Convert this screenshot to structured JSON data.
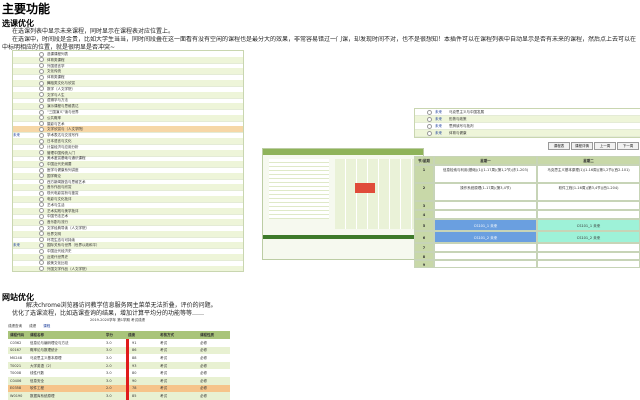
{
  "page": {
    "title": "主要功能"
  },
  "sec1": {
    "title": "选课优化",
    "lines": [
      "在选课列表中显示未来课程，同时显示在课程表对应位置上。",
      "在选课中，时间段是金贵，比如大学生当当，同时间段叠在这一面看有没有空闲的课程也是最分大的效果，非常容易错过一门课，却发现时间不对，也不是很想知！本插件可以在课程列表中自动显示是否有未来的课程，然后点上去可以在课程",
      "中标明相应的位置，就是很明显是否冲突~"
    ]
  },
  "tree_rows": [
    {
      "tag": "",
      "text": "选课课程列表"
    },
    {
      "tag": "",
      "text": "体育类课程"
    },
    {
      "tag": "",
      "text": "外国语言学"
    },
    {
      "tag": "",
      "text": "文化传统"
    },
    {
      "tag": "",
      "text": "体育类课程"
    },
    {
      "tag": "",
      "text": "舞蹈类文化与欣赏"
    },
    {
      "tag": "",
      "text": "数学（人文学院）"
    },
    {
      "tag": "",
      "text": "文学与人生"
    },
    {
      "tag": "",
      "text": "逻辑学与方法"
    },
    {
      "tag": "",
      "text": "演示课程与思维表达"
    },
    {
      "tag": "",
      "text": "“三国演义”读与世界"
    },
    {
      "tag": "",
      "text": "公共概率"
    },
    {
      "tag": "",
      "text": "摄影与艺术"
    },
    {
      "tag": "",
      "text": "文学欣赏与（人文学院）"
    },
    {
      "tag": "未来",
      "text": "学术表达与交流写作"
    },
    {
      "tag": "",
      "text": "日本语言与文化"
    },
    {
      "tag": "",
      "text": "计量经济与应用分析"
    },
    {
      "tag": "",
      "text": "管理中国传统入门"
    },
    {
      "tag": "",
      "text": "美术鉴赏基础与通识课程"
    },
    {
      "tag": "",
      "text": "中国近代史纲要"
    },
    {
      "tag": "",
      "text": "医学与健康系列讲座"
    },
    {
      "tag": "",
      "text": "国学概论"
    },
    {
      "tag": "",
      "text": "西方新闻报告与思维艺术"
    },
    {
      "tag": "",
      "text": "音乐作品与欣赏"
    },
    {
      "tag": "",
      "text": "现代电影赏析与鉴赏"
    },
    {
      "tag": "",
      "text": "电影与文化批评"
    },
    {
      "tag": "",
      "text": "艺术与生活"
    },
    {
      "tag": "",
      "text": "艺术实践与美学批评"
    },
    {
      "tag": "",
      "text": "中国书法艺术"
    },
    {
      "tag": "",
      "text": "音乐剧与流行"
    },
    {
      "tag": "",
      "text": "文学经典导读（人文学院）"
    },
    {
      "tag": "",
      "text": "世界文明"
    },
    {
      "tag": "",
      "text": "环境生态与可持续"
    },
    {
      "tag": "未来",
      "text": "国际关系与世界（世界以政和平）"
    },
    {
      "tag": "",
      "text": "中国近代经济史"
    },
    {
      "tag": "",
      "text": "近现代世界史"
    },
    {
      "tag": "",
      "text": "欧美文化比较"
    },
    {
      "tag": "",
      "text": "外国文学作品（人文学院）"
    }
  ],
  "top_rows": [
    {
      "tag": "未来",
      "text": "马克思主义与中国发展"
    },
    {
      "tag": "未来",
      "text": "形势与政策"
    },
    {
      "tag": "未来",
      "text": "思辨读写与批判"
    },
    {
      "tag": "未来",
      "text": "体育与健康"
    }
  ],
  "toolbar": {
    "buttons": [
      "课程表",
      "课程详情",
      "上一周",
      "下一周"
    ]
  },
  "grid": {
    "headers": [
      "节/星期",
      "星期一",
      "星期二"
    ],
    "cells": [
      [
        "1",
        "信息检索与利用(基础)(1)(1-17周)(第1,2节)(东1-203)",
        "马克思主义基本原理(1)(1-16周)(第1,2节)(西2-101)"
      ],
      [
        "2",
        "操作系统原理(1-17周)(第3,4节)",
        "软件工程(1-16周)(第3,4节)(西1-204)"
      ],
      [
        "3",
        "",
        ""
      ],
      [
        "4",
        "",
        ""
      ],
      [
        "5",
        "CS101_1 未来",
        "CS101_1 未来"
      ],
      [
        "6",
        "CS101_2 未来",
        "CS101_2 未来"
      ],
      [
        "7",
        "",
        ""
      ],
      [
        "8",
        "",
        ""
      ],
      [
        "9",
        "",
        ""
      ]
    ]
  },
  "sec2": {
    "title": "网站优化",
    "lines": [
      "解决chrome浏览器访问教学信息服务网主菜单无法折叠，评价的问题。",
      "优化了选课流程，比如选课查询的结果，增加计算平均分的功能等等……"
    ]
  },
  "table": {
    "caption": "2019-2020学年 第1学期  考试成绩",
    "crumb": [
      "成绩查询",
      "成绩",
      "课程"
    ],
    "headers": [
      "课程代码",
      "课程名称",
      "学分",
      "成绩",
      "考核方式",
      "课程性质"
    ],
    "rows": [
      [
        "C0362",
        "信息论与编码理论与方法",
        "3.0",
        "91",
        "考试",
        "必修"
      ],
      [
        "S0167",
        "概率论与数理统计",
        "3.0",
        "86",
        "考试",
        "必修"
      ],
      [
        "M0248",
        "马克思主义基本原理",
        "3.0",
        "88",
        "考试",
        "必修"
      ],
      [
        "T0021",
        "大学英语（2）",
        "2.0",
        "93",
        "考试",
        "必修"
      ],
      [
        "T0008",
        "线性代数",
        "3.0",
        "80",
        "考试",
        "必修"
      ],
      [
        "C0406",
        "信息安全",
        "3.0",
        "90",
        "考试",
        "必修"
      ],
      [
        "E0358",
        "软件工程",
        "2.0",
        "78",
        "考试",
        "必修"
      ],
      [
        "W0190",
        "数据库系统原理",
        "3.0",
        "85",
        "考试",
        "必修"
      ]
    ]
  }
}
